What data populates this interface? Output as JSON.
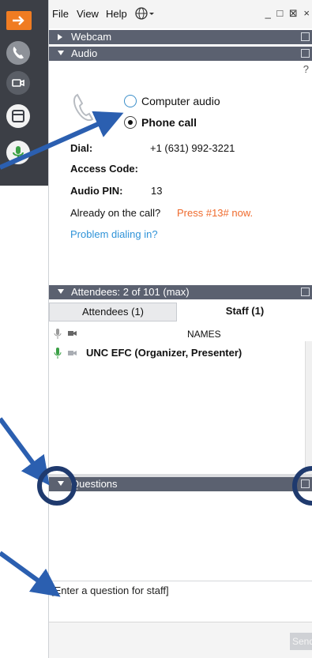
{
  "menubar": {
    "file": "File",
    "view": "View",
    "help": "Help",
    "window_controls": "_ □ ⊠ ×"
  },
  "sections": {
    "webcam": "Webcam",
    "audio": "Audio",
    "attendees_header": "Attendees:  2 of 101 (max)",
    "questions": "Questions"
  },
  "audio": {
    "help": "?",
    "option_computer": "Computer audio",
    "option_phone": "Phone call",
    "selected": "phone",
    "dial_label": "Dial:",
    "dial_value": "+1 (631) 992-3221",
    "access_code_label": "Access Code:",
    "audio_pin_label": "Audio PIN:",
    "audio_pin_value": "13",
    "already_text": "Already on the call?",
    "press_text": "Press #13# now.",
    "problem_link": "Problem dialing in?"
  },
  "attendees": {
    "tabs": [
      "Attendees (1)",
      "Staff (1)"
    ],
    "active_tab": "Staff (1)",
    "column_names": "NAMES",
    "rows": [
      {
        "name": "UNC EFC (Organizer, Presenter)"
      }
    ]
  },
  "questions": {
    "input_placeholder": "[Enter a question for staff]",
    "send_label": "Send"
  },
  "colors": {
    "toolbar_bg": "#3c3f46",
    "accent_orange": "#f07c22",
    "section_bar": "#5b6170",
    "link_blue": "#2f93d8",
    "press_orange": "#ef6a2c",
    "annotation_blue": "#2b5fb0",
    "mic_green": "#3aa045"
  },
  "icons": [
    "arrow-right-icon",
    "phone-icon",
    "webcam-icon",
    "window-icon",
    "mic-icon",
    "globe-icon",
    "handset-icon"
  ]
}
